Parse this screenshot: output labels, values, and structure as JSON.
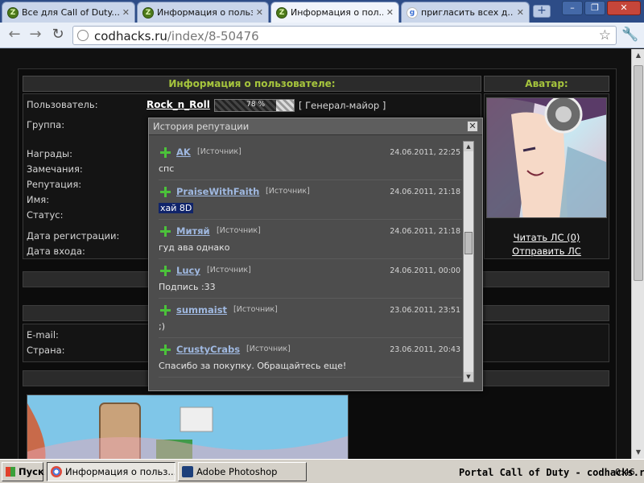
{
  "browser": {
    "tabs": [
      {
        "label": "Все для Call of Duty...",
        "favicon": "Z"
      },
      {
        "label": "Информация о польз...",
        "favicon": "Z"
      },
      {
        "label": "Информация о пол...",
        "favicon": "Z"
      },
      {
        "label": "пригласить всех д...",
        "favicon": "g"
      }
    ],
    "new_tab": "+",
    "close": "✕",
    "url_host": "codhacks.ru",
    "url_path": "/index/8-50476"
  },
  "page": {
    "info_header": "Информация о пользователе:",
    "avatar_header": "Аватар:",
    "labels": {
      "user": "Пользователь:",
      "group": "Группа:",
      "awards": "Награды:",
      "warnings": "Замечания:",
      "reputation": "Репутация:",
      "name": "Имя:",
      "status": "Статус:",
      "reg_date": "Дата регистрации:",
      "login_date": "Дата входа:",
      "email": "E-mail:",
      "country": "Страна:"
    },
    "username": "Rock_n_Roll",
    "rep_percent": "78 %",
    "rep_level": 0.78,
    "rank": "[ Генерал-майор ]",
    "read_pm": "Читать ЛС (0)",
    "send_pm": "Отправить ЛС"
  },
  "modal": {
    "title": "История репутации",
    "close": "✕",
    "source_label": "[Источник]",
    "entries": [
      {
        "name": "AK",
        "date": "24.06.2011, 22:25",
        "text": "спс",
        "selected": false
      },
      {
        "name": "PraiseWithFaith",
        "date": "24.06.2011, 21:18",
        "text": "хай 8D",
        "selected": true
      },
      {
        "name": "Митяй",
        "date": "24.06.2011, 21:18",
        "text": "гуд ава однако",
        "selected": false
      },
      {
        "name": "Lucy",
        "date": "24.06.2011, 00:00",
        "text": "Подпись :33",
        "selected": false
      },
      {
        "name": "summaist",
        "date": "23.06.2011, 23:51",
        "text": ";)",
        "selected": false
      },
      {
        "name": "CrustyCrabs",
        "date": "23.06.2011, 20:43",
        "text": "Спасибо за покупку. Обращайтесь еще!",
        "selected": false
      }
    ]
  },
  "taskbar": {
    "start": "Пуск",
    "items": [
      "Информация о польз...",
      "Adobe Photoshop"
    ],
    "tray_text": "Portal Call of Duty - codhacks.ru",
    "clock": "0:46"
  },
  "colors": {
    "accent_green": "#a6c53d",
    "plus_green": "#4bc23a",
    "selection": "#10246a"
  }
}
